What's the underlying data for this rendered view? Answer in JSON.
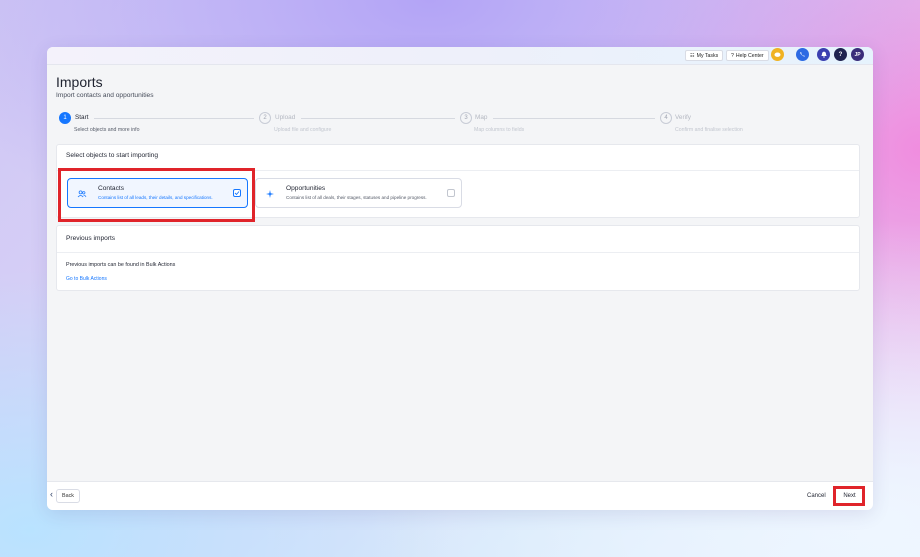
{
  "topbar": {
    "my_tasks": "My Tasks",
    "help_center": "Help Center",
    "avatar_initials": "JP"
  },
  "page": {
    "title": "Imports",
    "subtitle": "Import contacts and opportunities"
  },
  "steps": [
    {
      "number": "1",
      "title": "Start",
      "description": "Select objects and more info",
      "active": true
    },
    {
      "number": "2",
      "title": "Upload",
      "description": "Upload file and configure",
      "active": false
    },
    {
      "number": "3",
      "title": "Map",
      "description": "Map columns to fields",
      "active": false
    },
    {
      "number": "4",
      "title": "Verify",
      "description": "Confirm and finalise selection",
      "active": false
    }
  ],
  "select_section": {
    "heading": "Select objects to start importing",
    "options": [
      {
        "title": "Contacts",
        "description": "Contains list of all leads, their details, and specifications.",
        "selected": true,
        "icon": "people-icon"
      },
      {
        "title": "Opportunities",
        "description": "Contains list of all deals, their stages, statuses and pipeline progress.",
        "selected": false,
        "icon": "sparkle-icon"
      }
    ]
  },
  "previous_section": {
    "heading": "Previous imports",
    "text": "Previous imports can be found in Bulk Actions",
    "link": "Go to Bulk Actions"
  },
  "footer": {
    "back_label": "Back",
    "cancel_label": "Cancel",
    "next_label": "Next"
  },
  "colors": {
    "accent": "#1677ff",
    "highlight": "#e0242a"
  }
}
